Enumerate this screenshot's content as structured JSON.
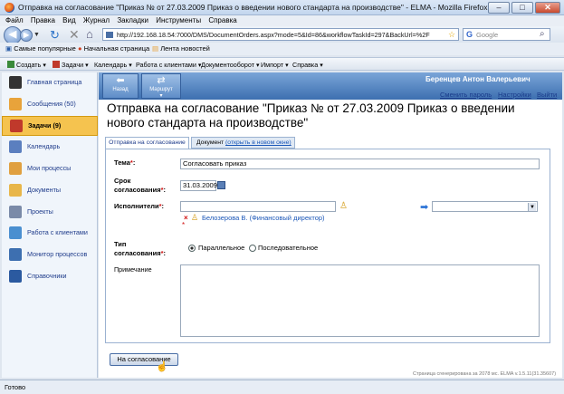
{
  "window": {
    "title": "Отправка на согласование \"Приказ № от 27.03.2009 Приказ о введении нового стандарта на производстве\" - ELMA - Mozilla Firefox",
    "min": "–",
    "max": "□",
    "close": "✕"
  },
  "menu": [
    "Файл",
    "Правка",
    "Вид",
    "Журнал",
    "Закладки",
    "Инструменты",
    "Справка"
  ],
  "nav": {
    "url": "http://192.168.18.54:7000/DMS/DocumentOrders.aspx?mode=5&Id=86&workflowTaskId=297&BackUrl=%2F",
    "search_placeholder": "Google",
    "search_engine_glyph": "G"
  },
  "bookmarks": [
    "Самые популярные",
    "Начальная страница",
    "Лента новостей"
  ],
  "elma_menu": [
    "Создать",
    "Задачи",
    "Календарь",
    "Работа с клиентами",
    "Документооборот",
    "Импорт",
    "Справка"
  ],
  "sidebar": [
    {
      "label": "Главная страница",
      "icon": "home-icon",
      "color": "#333333"
    },
    {
      "label": "Сообщения (50)",
      "icon": "messages-icon",
      "color": "#e8a33b"
    },
    {
      "label": "Задачи (9)",
      "icon": "tasks-icon",
      "color": "#c0392b",
      "active": true
    },
    {
      "label": "Календарь",
      "icon": "calendar-icon",
      "color": "#5b7fbf"
    },
    {
      "label": "Мои процессы",
      "icon": "processes-icon",
      "color": "#e0a040"
    },
    {
      "label": "Документы",
      "icon": "documents-icon",
      "color": "#e8b64a"
    },
    {
      "label": "Проекты",
      "icon": "projects-icon",
      "color": "#7a8aa8"
    },
    {
      "label": "Работа с клиентами",
      "icon": "clients-icon",
      "color": "#4a8fd0"
    },
    {
      "label": "Монитор процессов",
      "icon": "monitor-icon",
      "color": "#3d6fb0"
    },
    {
      "label": "Справочники",
      "icon": "reference-icon",
      "color": "#2b5aa0"
    }
  ],
  "toolbar": {
    "back": "Назад",
    "route": "Маршрут"
  },
  "user": {
    "name": "Беренцев Антон Валерьевич",
    "change_password": "Сменить пароль",
    "settings": "Настройки",
    "logout": "Выйти"
  },
  "page": {
    "title": "Отправка на согласование \"Приказ № от 27.03.2009 Приказ о введении нового стандарта на производстве\""
  },
  "tabs": {
    "active": "Отправка на согласование",
    "doc": "Документ",
    "doc_link": "(открыть в новом окне)"
  },
  "form": {
    "topic_label": "Тема",
    "topic_value": "Согласовать приказ",
    "deadline_label1": "Срок",
    "deadline_label2": "согласования",
    "deadline_value": "31.03.2009",
    "executors_label": "Исполнители",
    "executor": "Белозерова В. (Финансовый директор)",
    "type_label1": "Тип",
    "type_label2": "согласования",
    "opt_parallel": "Параллельное",
    "opt_sequential": "Последовательное",
    "selected": "parallel",
    "note_label": "Примечание"
  },
  "submit": "На согласование",
  "footnote": "Страница сгенерирована за 2078 мс. ELMA v.1.5.11(31.35607)",
  "status": "Готово"
}
